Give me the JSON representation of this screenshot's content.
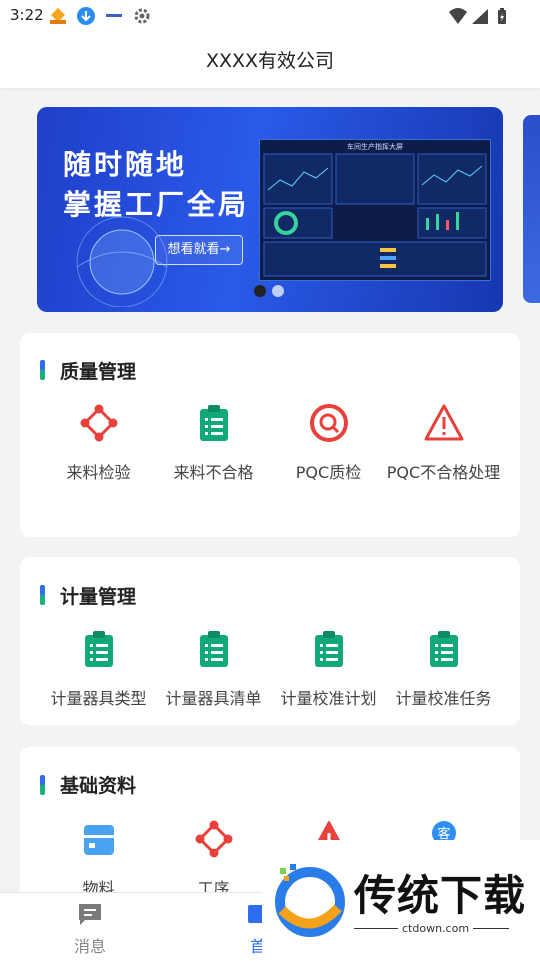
{
  "status_bar": {
    "time": "3:22",
    "icons": [
      "app-badge-icon",
      "download-icon",
      "small-logo-icon",
      "settings-icon",
      "wifi-icon",
      "signal-icon",
      "battery-icon"
    ]
  },
  "app_bar": {
    "title": "XXXX有效公司"
  },
  "banner": {
    "line1": "随时随地",
    "line2": "掌握工厂全局",
    "button": "想看就看→",
    "dashboard_title": "车间生产指挥大屏",
    "page_count": 2,
    "active_page": 1
  },
  "sections": [
    {
      "title": "质量管理",
      "items": [
        {
          "label": "来料检验",
          "icon": "nodes-icon"
        },
        {
          "label": "来料不合格",
          "icon": "clipboard-icon"
        },
        {
          "label": "PQC质检",
          "icon": "search-circle-icon"
        },
        {
          "label": "PQC不合格处理",
          "icon": "warning-icon"
        }
      ]
    },
    {
      "title": "计量管理",
      "items": [
        {
          "label": "计量器具类型",
          "icon": "clipboard-icon"
        },
        {
          "label": "计量器具清单",
          "icon": "clipboard-icon"
        },
        {
          "label": "计量校准计划",
          "icon": "clipboard-icon"
        },
        {
          "label": "计量校准任务",
          "icon": "clipboard-icon"
        }
      ]
    },
    {
      "title": "基础资料",
      "items": [
        {
          "label": "物料",
          "icon": "box-icon"
        },
        {
          "label": "工序",
          "icon": "nodes-icon"
        },
        {
          "label": "",
          "icon": "warning-icon"
        },
        {
          "label": "",
          "icon": "customer-icon",
          "glyph": "客"
        }
      ]
    }
  ],
  "bottom_nav": [
    {
      "label": "消息",
      "icon": "message-icon"
    },
    {
      "label": "首",
      "icon": "home-icon"
    }
  ],
  "watermark": {
    "text": "传统下载",
    "url": "ctdown.com"
  },
  "colors": {
    "accent_blue": "#2f6df0",
    "accent_green": "#18b27a",
    "red": "#e8403a",
    "teal": "#12a97a"
  }
}
